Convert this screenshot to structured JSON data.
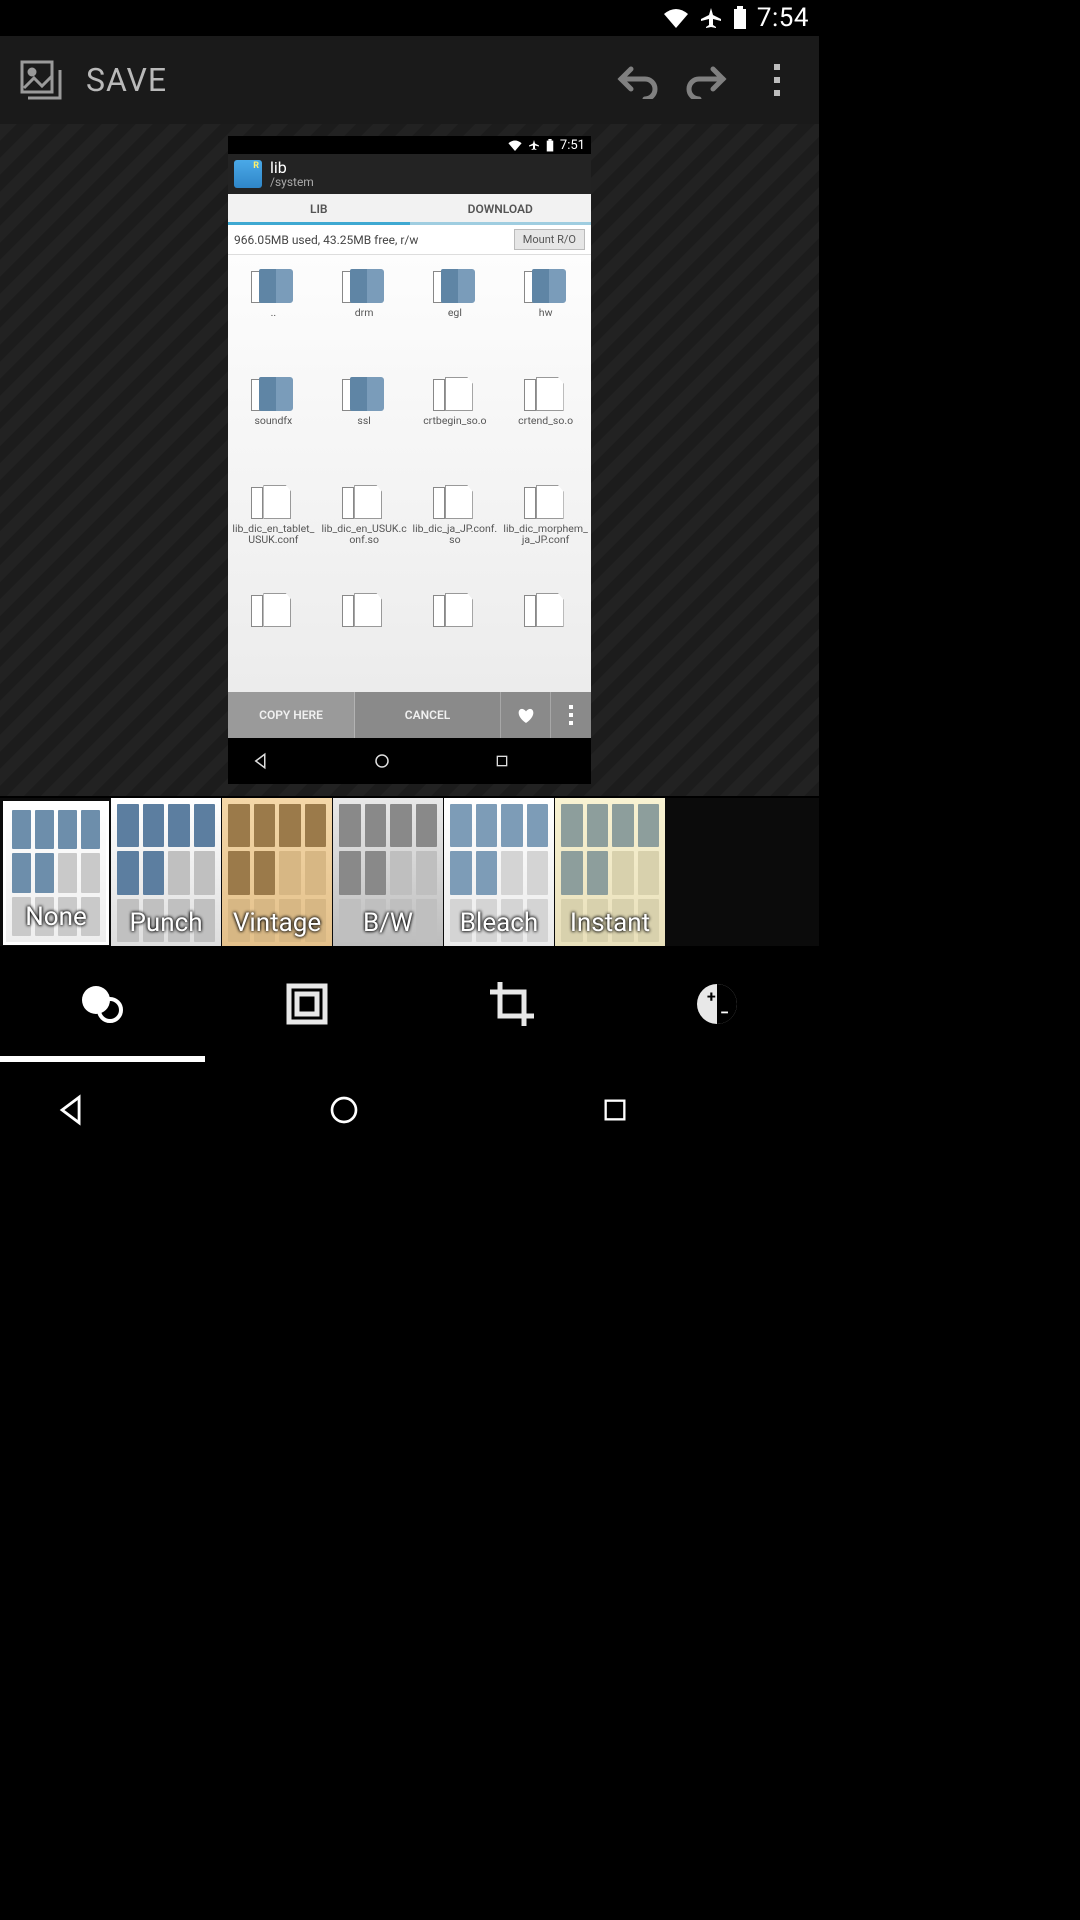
{
  "status_bar": {
    "time": "7:54",
    "wifi_icon": "wifi-full",
    "airplane_icon": "airplane-mode",
    "battery_icon": "battery-full"
  },
  "app_bar": {
    "save_label": "SAVE"
  },
  "inner_screenshot": {
    "status_time": "7:51",
    "title": "lib",
    "path": "/system",
    "tabs": {
      "lib": "LIB",
      "download": "DOWNLOAD"
    },
    "storage_text": "966.05MB used, 43.25MB free, r/w",
    "mount_button": "Mount R/O",
    "files": [
      {
        "name": "..",
        "type": "folder"
      },
      {
        "name": "drm",
        "type": "folder"
      },
      {
        "name": "egl",
        "type": "folder"
      },
      {
        "name": "hw",
        "type": "folder"
      },
      {
        "name": "soundfx",
        "type": "folder"
      },
      {
        "name": "ssl",
        "type": "folder"
      },
      {
        "name": "crtbegin_so.o",
        "type": "file"
      },
      {
        "name": "crtend_so.o",
        "type": "file"
      },
      {
        "name": "lib_dic_en_tablet_USUK.conf",
        "type": "file"
      },
      {
        "name": "lib_dic_en_USUK.conf.so",
        "type": "file"
      },
      {
        "name": "lib_dic_ja_JP.conf.so",
        "type": "file"
      },
      {
        "name": "lib_dic_morphem_ja_JP.conf",
        "type": "file"
      },
      {
        "name": "",
        "type": "file"
      },
      {
        "name": "",
        "type": "file"
      },
      {
        "name": "",
        "type": "file"
      },
      {
        "name": "",
        "type": "file"
      }
    ],
    "actions": {
      "copy": "COPY HERE",
      "cancel": "CANCEL"
    }
  },
  "filters": [
    {
      "label": "None",
      "selected": true
    },
    {
      "label": "Punch",
      "selected": false
    },
    {
      "label": "Vintage",
      "selected": false
    },
    {
      "label": "B/W",
      "selected": false
    },
    {
      "label": "Bleach",
      "selected": false
    },
    {
      "label": "Instant",
      "selected": false
    }
  ],
  "tools": {
    "effects": "filter-effects",
    "frame": "frame",
    "crop": "crop",
    "adjust": "exposure-adjust"
  }
}
